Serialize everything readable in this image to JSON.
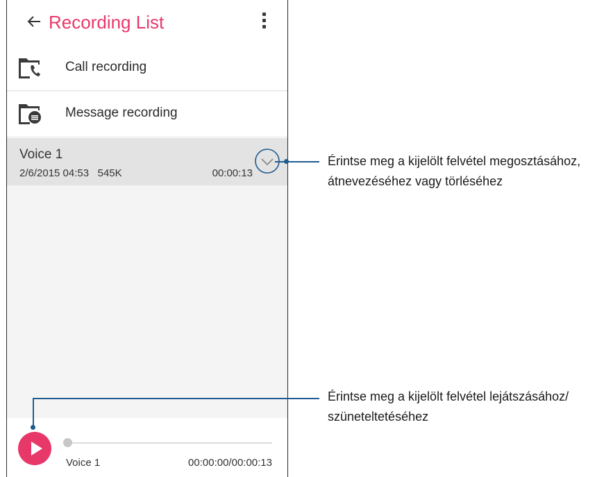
{
  "header": {
    "title": "Recording List"
  },
  "folders": [
    {
      "label": "Call recording",
      "icon": "call-folder-icon"
    },
    {
      "label": "Message recording",
      "icon": "message-folder-icon"
    }
  ],
  "recording": {
    "name": "Voice 1",
    "meta": "2/6/2015 04:53   545K",
    "duration": "00:00:13"
  },
  "player": {
    "name": "Voice 1",
    "time": "00:00:00/00:00:13",
    "progress": 0
  },
  "callouts": [
    {
      "line1": "Érintse meg a kijelölt felvétel megosztásához,",
      "line2": "átnevezéséhez vagy törléséhez"
    },
    {
      "line1": "Érintse meg a kijelölt felvétel lejátszásához/",
      "line2": "szüneteltetéséhez"
    }
  ],
  "colors": {
    "accent": "#e8386a",
    "callout": "#1f5b8f"
  }
}
